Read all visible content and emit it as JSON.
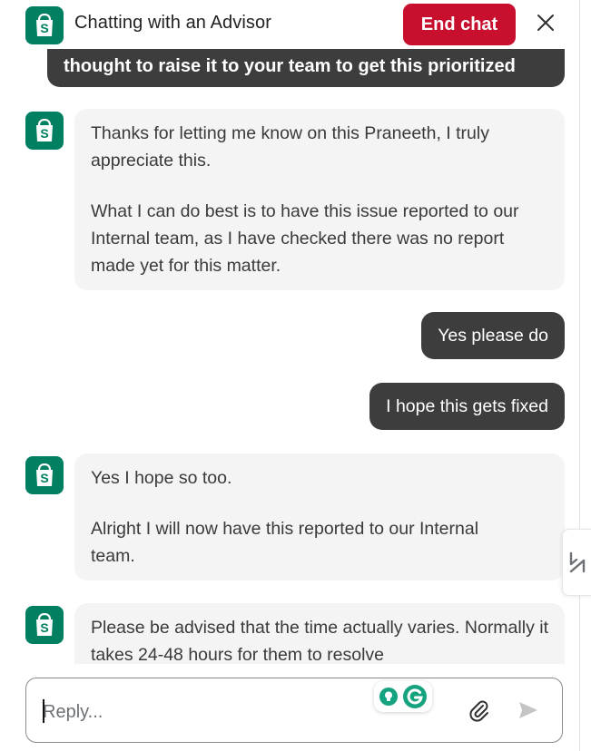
{
  "header": {
    "title": "Chatting with an Advisor",
    "end_chat_label": "End chat",
    "brand_color": "#008060",
    "end_chat_color": "#C8102E"
  },
  "messages": [
    {
      "sender": "user",
      "paragraphs": [
        "thought to raise it to your team to get this prioritized"
      ]
    },
    {
      "sender": "agent",
      "paragraphs": [
        "Thanks for letting me know on this Praneeth, I truly appreciate this.",
        "What I can do best is to have this issue reported to our Internal team, as I have checked there was no report made yet for this matter."
      ]
    },
    {
      "sender": "user",
      "paragraphs": [
        "Yes please do"
      ]
    },
    {
      "sender": "user",
      "paragraphs": [
        "I hope this gets fixed"
      ]
    },
    {
      "sender": "agent",
      "paragraphs": [
        "Yes I hope so too.",
        "Alright I will now have this reported to our Internal team."
      ]
    },
    {
      "sender": "agent",
      "paragraphs": [
        "Please be advised that the time actually varies. Normally it takes 24-48 hours for them to resolve"
      ]
    }
  ],
  "composer": {
    "placeholder": "Reply...",
    "value": ""
  },
  "icons": {
    "brand": "shopify-bag-icon",
    "close": "close-icon",
    "attach": "paperclip-icon",
    "send": "send-arrow-icon",
    "grammarly": "grammarly-icon",
    "side_tab": "side-widget-icon"
  }
}
